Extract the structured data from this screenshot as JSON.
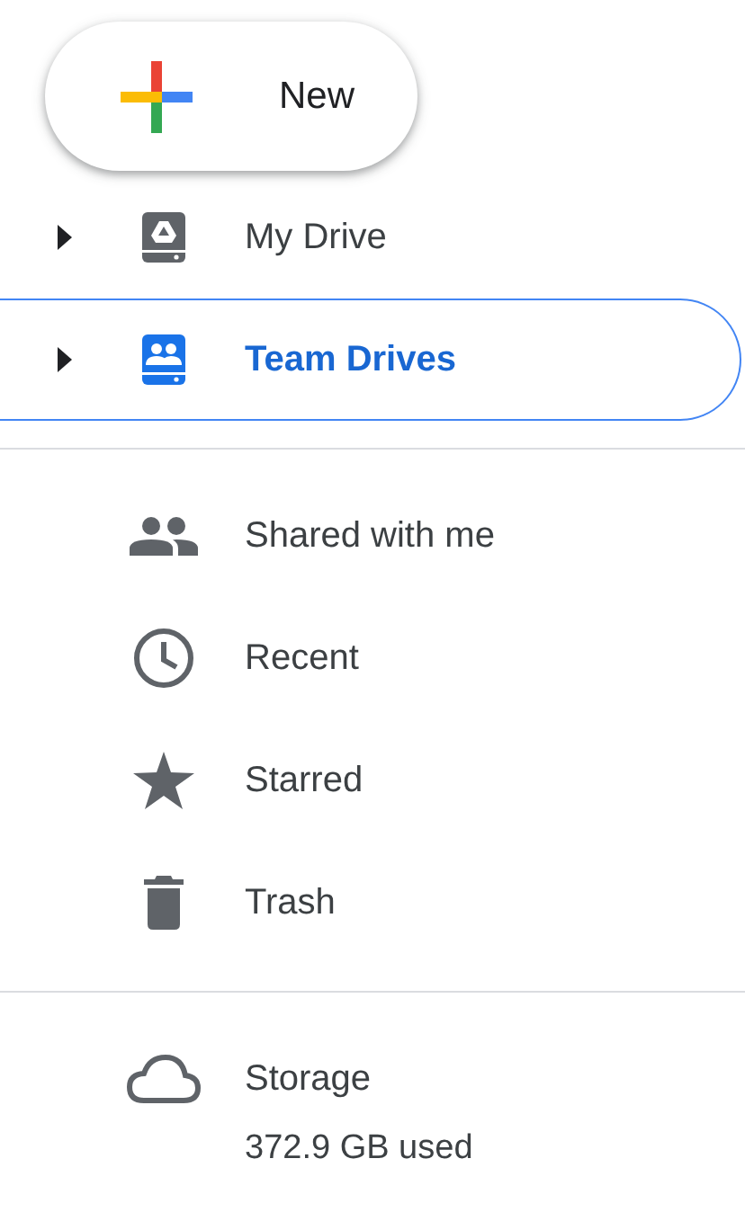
{
  "new_button": {
    "label": "New"
  },
  "drives": [
    {
      "label": "My Drive",
      "expanded": false,
      "selected": false
    },
    {
      "label": "Team Drives",
      "expanded": false,
      "selected": true
    }
  ],
  "places": [
    {
      "label": "Shared with me"
    },
    {
      "label": "Recent"
    },
    {
      "label": "Starred"
    },
    {
      "label": "Trash"
    }
  ],
  "storage": {
    "label": "Storage",
    "usage": "372.9 GB used"
  }
}
